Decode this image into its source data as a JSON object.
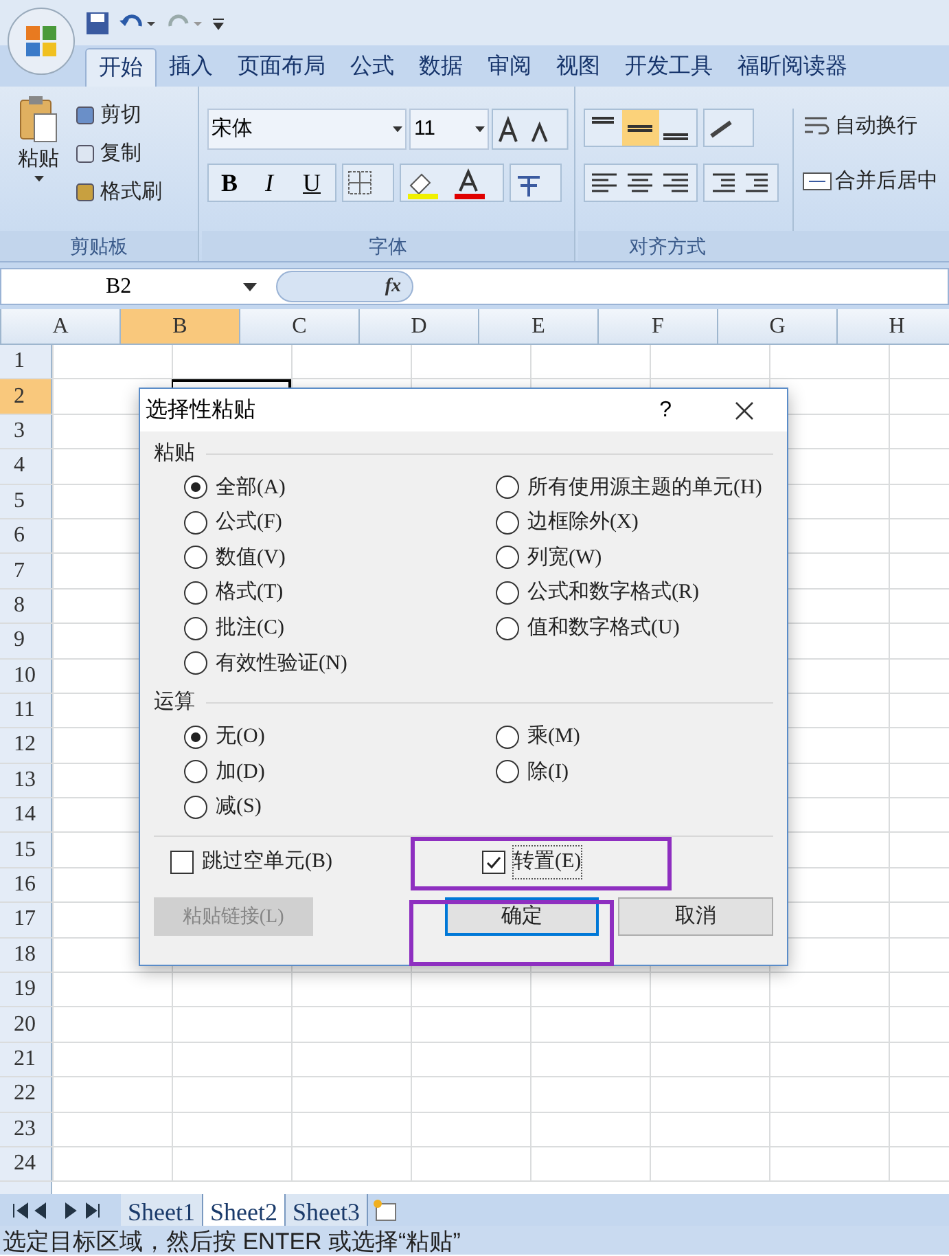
{
  "ribbon_tabs": [
    {
      "label": "开始",
      "selected": true
    },
    {
      "label": "插入",
      "selected": false
    },
    {
      "label": "页面布局",
      "selected": false
    },
    {
      "label": "公式",
      "selected": false
    },
    {
      "label": "数据",
      "selected": false
    },
    {
      "label": "审阅",
      "selected": false
    },
    {
      "label": "视图",
      "selected": false
    },
    {
      "label": "开发工具",
      "selected": false
    },
    {
      "label": "福昕阅读器",
      "selected": false
    }
  ],
  "clipboard": {
    "paste": "粘贴",
    "cut": "剪切",
    "copy": "复制",
    "format_painter": "格式刷",
    "group_label": "剪贴板"
  },
  "font": {
    "name": "宋体",
    "size": "11",
    "bold": "B",
    "italic": "I",
    "underline": "U",
    "group_label": "字体"
  },
  "alignment": {
    "wrap_text": "自动换行",
    "merge_center": "合并后居中",
    "group_label": "对齐方式"
  },
  "name_box": "B2",
  "formula_label": "fx",
  "columns": [
    {
      "label": "A",
      "selected": false
    },
    {
      "label": "B",
      "selected": true
    },
    {
      "label": "C",
      "selected": false
    },
    {
      "label": "D",
      "selected": false
    },
    {
      "label": "E",
      "selected": false
    },
    {
      "label": "F",
      "selected": false
    },
    {
      "label": "G",
      "selected": false
    },
    {
      "label": "H",
      "selected": false
    }
  ],
  "rows": [
    {
      "label": "1",
      "selected": false
    },
    {
      "label": "2",
      "selected": true
    },
    {
      "label": "3",
      "selected": false
    },
    {
      "label": "4",
      "selected": false
    },
    {
      "label": "5",
      "selected": false
    },
    {
      "label": "6",
      "selected": false
    },
    {
      "label": "7",
      "selected": false
    },
    {
      "label": "8",
      "selected": false
    },
    {
      "label": "9",
      "selected": false
    },
    {
      "label": "10",
      "selected": false
    },
    {
      "label": "11",
      "selected": false
    },
    {
      "label": "12",
      "selected": false
    },
    {
      "label": "13",
      "selected": false
    },
    {
      "label": "14",
      "selected": false
    },
    {
      "label": "15",
      "selected": false
    },
    {
      "label": "16",
      "selected": false
    },
    {
      "label": "17",
      "selected": false
    },
    {
      "label": "18",
      "selected": false
    },
    {
      "label": "19",
      "selected": false
    },
    {
      "label": "20",
      "selected": false
    },
    {
      "label": "21",
      "selected": false
    },
    {
      "label": "22",
      "selected": false
    },
    {
      "label": "23",
      "selected": false
    },
    {
      "label": "24",
      "selected": false
    }
  ],
  "dialog": {
    "title": "选择性粘贴",
    "help": "?",
    "paste_group": {
      "label": "粘贴",
      "left": [
        {
          "label": "全部(A)",
          "selected": true
        },
        {
          "label": "公式(F)",
          "selected": false
        },
        {
          "label": "数值(V)",
          "selected": false
        },
        {
          "label": "格式(T)",
          "selected": false
        },
        {
          "label": "批注(C)",
          "selected": false
        },
        {
          "label": "有效性验证(N)",
          "selected": false
        }
      ],
      "right": [
        {
          "label": "所有使用源主题的单元(H)",
          "selected": false
        },
        {
          "label": "边框除外(X)",
          "selected": false
        },
        {
          "label": "列宽(W)",
          "selected": false
        },
        {
          "label": "公式和数字格式(R)",
          "selected": false
        },
        {
          "label": "值和数字格式(U)",
          "selected": false
        }
      ]
    },
    "operation_group": {
      "label": "运算",
      "left": [
        {
          "label": "无(O)",
          "selected": true
        },
        {
          "label": "加(D)",
          "selected": false
        },
        {
          "label": "减(S)",
          "selected": false
        }
      ],
      "right": [
        {
          "label": "乘(M)",
          "selected": false
        },
        {
          "label": "除(I)",
          "selected": false
        }
      ]
    },
    "skip_blanks": {
      "label": "跳过空单元(B)",
      "checked": false
    },
    "transpose": {
      "label": "转置(E)",
      "checked": true,
      "highlighted": true
    },
    "paste_link": {
      "label": "粘贴链接(L)",
      "disabled": true
    },
    "ok": {
      "label": "确定",
      "highlighted": true
    },
    "cancel": {
      "label": "取消"
    }
  },
  "sheet_tabs": [
    {
      "label": "Sheet1",
      "selected": false
    },
    {
      "label": "Sheet2",
      "selected": true
    },
    {
      "label": "Sheet3",
      "selected": false
    }
  ],
  "status_bar": "选定目标区域，然后按 ENTER 或选择“粘贴”"
}
